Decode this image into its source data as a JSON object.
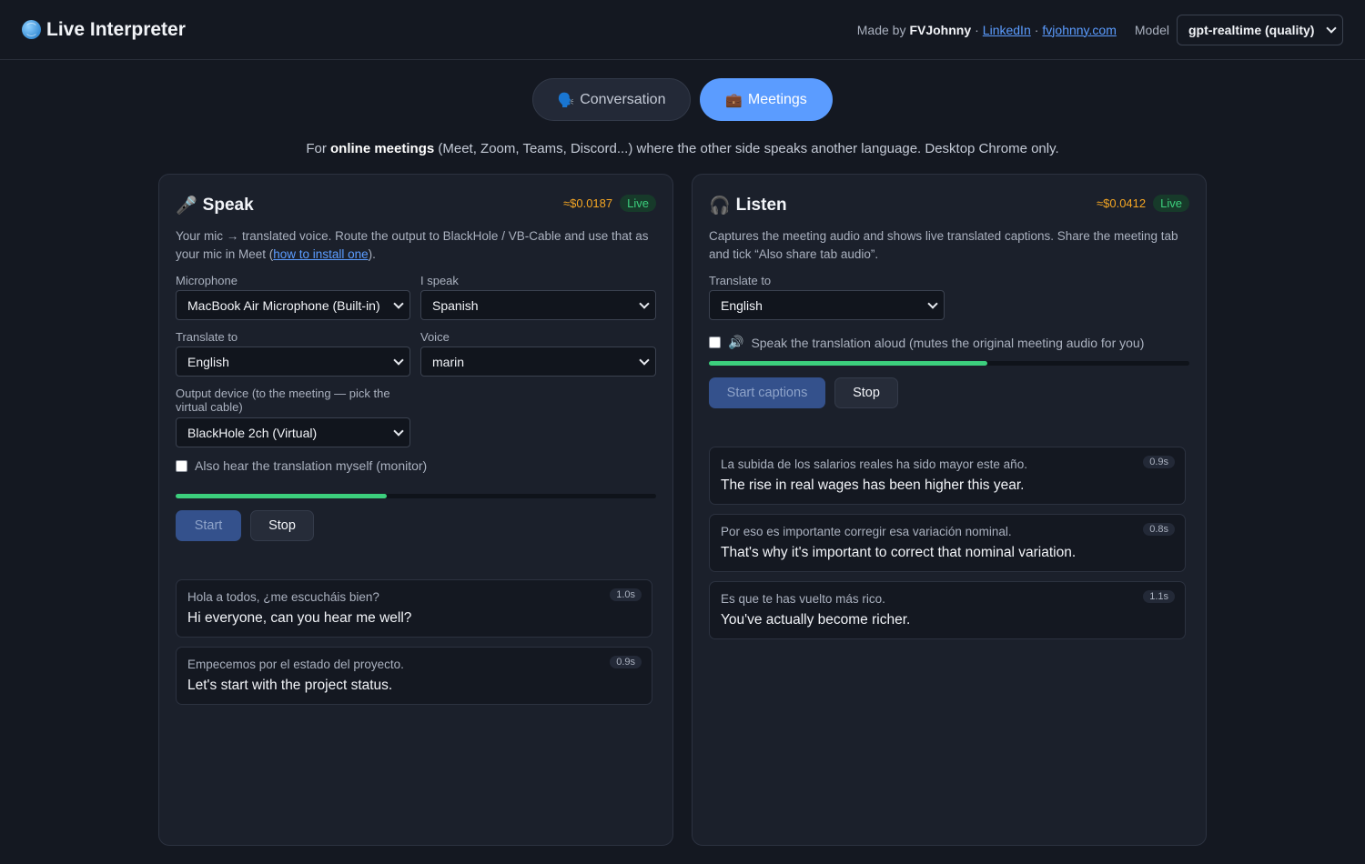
{
  "app": {
    "title": "Live Interpreter",
    "made_by_prefix": "Made by",
    "author": "FVJohnny",
    "separator": "·",
    "link_linkedin": "LinkedIn",
    "link_site": "fvjohnny.com",
    "model_label": "Model",
    "model_value": "gpt-realtime (quality)"
  },
  "tabs": [
    {
      "label": "Conversation",
      "icon": "speaking-head-icon"
    },
    {
      "label": "Meetings",
      "icon": "briefcase-icon",
      "active": true
    }
  ],
  "subtitle": {
    "prefix": "For",
    "bold": "online meetings",
    "rest": "(Meet, Zoom, Teams, Discord...) where the other side speaks another language. Desktop Chrome only."
  },
  "speak": {
    "title": "Speak",
    "icon": "microphone-icon",
    "cost": "≈$0.0187",
    "status": "Live",
    "desc_a": "Your mic → translated voice. Route the output to BlackHole / VB-Cable and use that as your mic in Meet (",
    "desc_link": "how to install one",
    "desc_b": ").",
    "microphone_label": "Microphone",
    "microphone_value": "MacBook Air Microphone (Built-in)",
    "i_speak_label": "I speak",
    "i_speak_value": "Spanish",
    "translate_label": "Translate to",
    "translate_value": "English",
    "voice_label": "Voice",
    "voice_value": "marin",
    "output_label": "Output device (to the meeting — pick the virtual cable)",
    "output_value": "BlackHole 2ch (Virtual)",
    "monitor_label": "Also hear the translation myself (monitor)",
    "level": 0.44,
    "start_label": "Start",
    "stop_label": "Stop",
    "entries": [
      {
        "source": "Hola a todos, ¿me escucháis bien?",
        "translation": "Hi everyone, can you hear me well?",
        "latency": "1.0s"
      },
      {
        "source": "Empecemos por el estado del proyecto.",
        "translation": "Let's start with the project status.",
        "latency": "0.9s"
      }
    ]
  },
  "listen": {
    "title": "Listen",
    "icon": "headphones-icon",
    "cost": "≈$0.0412",
    "status": "Live",
    "desc": "Captures the meeting audio and shows live translated captions. Share the meeting tab and tick “Also share tab audio”.",
    "translate_label": "Translate to",
    "translate_value": "English",
    "speak_aloud_label": "Speak the translation aloud (mutes the original meeting audio for you)",
    "speak_aloud_icon": "speaker-icon",
    "level": 0.58,
    "start_label": "Start captions",
    "stop_label": "Stop",
    "entries": [
      {
        "source": "La subida de los salarios reales ha sido mayor este año.",
        "translation": "The rise in real wages has been higher this year.",
        "latency": "0.9s"
      },
      {
        "source": "Por eso es importante corregir esa variación nominal.",
        "translation": "That's why it's important to correct that nominal variation.",
        "latency": "0.8s"
      },
      {
        "source": "Es que te has vuelto más rico.",
        "translation": "You've actually become richer.",
        "latency": "1.1s"
      }
    ]
  },
  "colors": {
    "background": "#141821",
    "accent": "#5b9cff",
    "live_green": "#3ccf7d",
    "cost_orange": "#f5a623"
  }
}
